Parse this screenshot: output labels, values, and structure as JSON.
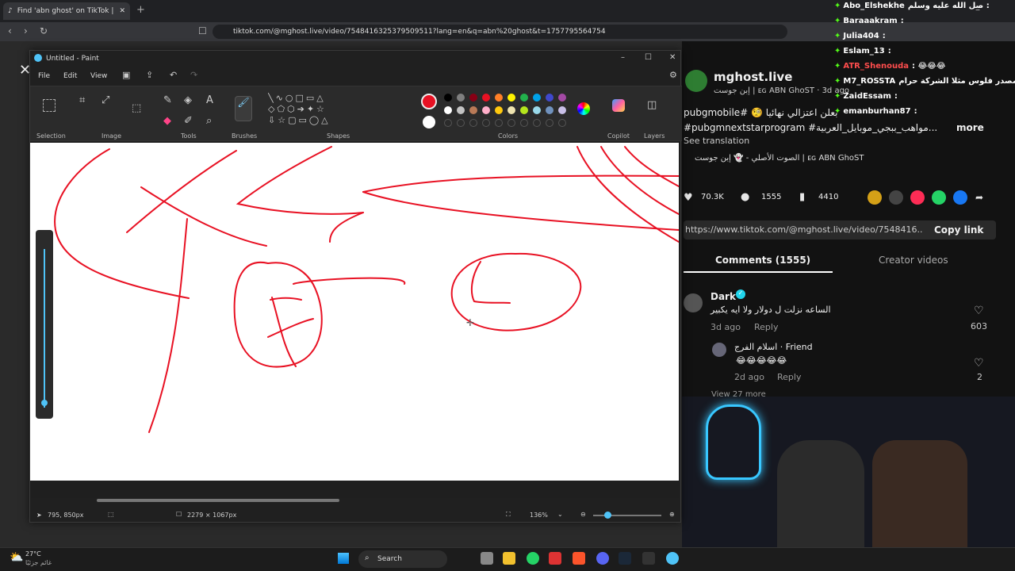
{
  "browser": {
    "tab_title": "Find 'abn ghost' on TikTok | TikTok",
    "url": "tiktok.com/@mghost.live/video/7548416325379509511?lang=en&q=abn%20ghost&t=1757795564754"
  },
  "tiktok": {
    "username": "mghost.live",
    "subtitle": "إبن جوست | ᴇɢ ABN GhoST · 3d ago",
    "description_line1": "بعلن اعتزالي نهائيا 🧐 #pubgmobile",
    "description_line2": "#pubgmnextstarprogram #مواهب_ببجي_موبايل_العربية...",
    "more_label": "more",
    "see_translation": "See translation",
    "sound": "الصوت الأصلي - 👻 إبن جوست | ᴇɢ ABN GhoST",
    "likes": "70.3K",
    "comments_count": "1555",
    "saves": "4410",
    "link": "https://www.tiktok.com/@mghost.live/video/7548416...",
    "copy_link": "Copy link",
    "tab_comments": "Comments (1555)",
    "tab_creator": "Creator videos",
    "comment1": {
      "user": "Dark",
      "text": "الساعه نزلت ل دولار ولا ايه يكبير",
      "age": "3d ago",
      "reply": "Reply",
      "likes": "603"
    },
    "comment2": {
      "user": "اسلام الفرج · Friend",
      "text": "😂😂😂😂😂",
      "age": "2d ago",
      "reply": "Reply",
      "likes": "2"
    },
    "view_more": "View 27 more"
  },
  "paint": {
    "title": "Untitled - Paint",
    "menu": [
      "File",
      "Edit",
      "View"
    ],
    "groups": [
      "Selection",
      "Image",
      "Tools",
      "Brushes",
      "Shapes",
      "Colors",
      "Copilot",
      "Layers"
    ],
    "cursor_pos": "795, 850px",
    "canvas_size": "2279 × 1067px",
    "zoom": "136%",
    "primary_color": "#e81123"
  },
  "chat": [
    {
      "user": "Abo_Elshekhe",
      "msg": "صل الله عليه وسلم :"
    },
    {
      "user": "Baraaakram",
      "msg": ":"
    },
    {
      "user": "Julia404",
      "msg": ":"
    },
    {
      "user": "Eslam_13",
      "msg": ":"
    },
    {
      "user": "ATR_Shenouda",
      "msg": ": 😂😂😂"
    },
    {
      "user": "M7_ROSSTA",
      "msg": "ن مصدر فلوس مثلا الشركة حرام :"
    },
    {
      "user": "ZaidEssam",
      "msg": ":"
    },
    {
      "user": "emanburhan87",
      "msg": ":"
    }
  ],
  "taskbar": {
    "weather_temp": "27°C",
    "weather_desc": "غائم جزئيًا",
    "search": "Search"
  }
}
